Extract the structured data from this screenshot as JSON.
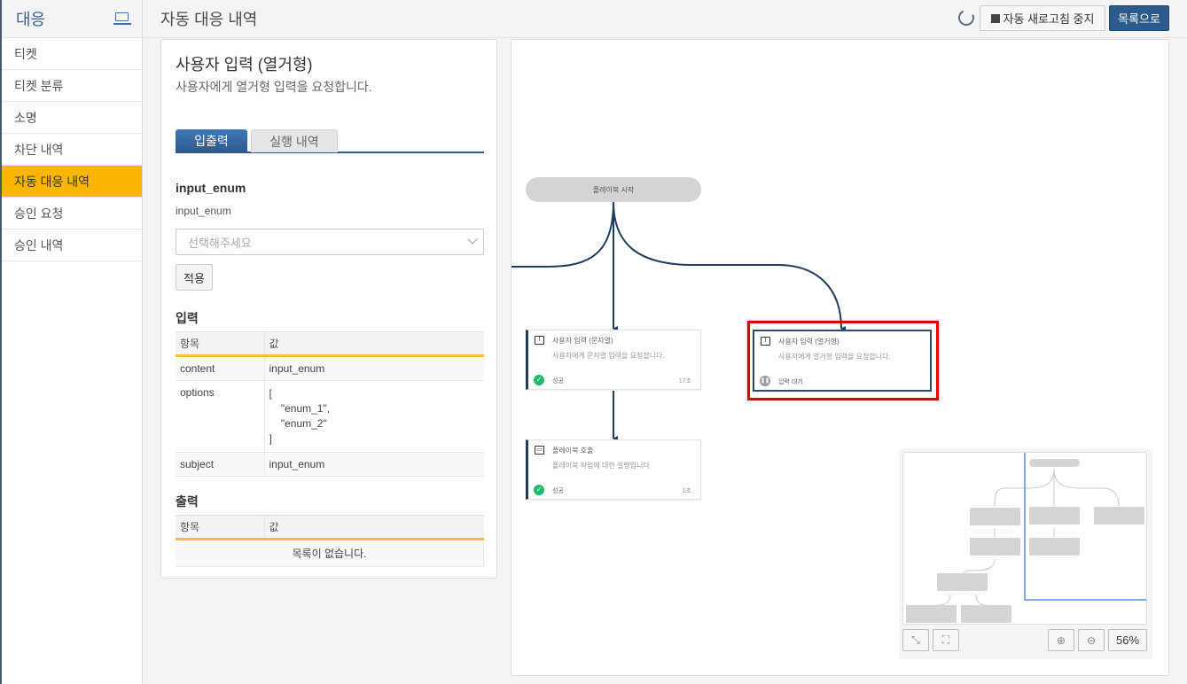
{
  "sidebar": {
    "title": "대응",
    "icon": "laptop-icon",
    "items": [
      {
        "label": "티켓",
        "active": false
      },
      {
        "label": "티켓 분류",
        "active": false
      },
      {
        "label": "소명",
        "active": false
      },
      {
        "label": "차단 내역",
        "active": false
      },
      {
        "label": "자동 대응 내역",
        "active": true
      },
      {
        "label": "승인 요청",
        "active": false
      },
      {
        "label": "승인 내역",
        "active": false
      }
    ]
  },
  "header": {
    "title": "자동 대응 내역",
    "refresh_button": "자동 새로고침 중지",
    "list_button": "목록으로"
  },
  "detail": {
    "title": "사용자 입력 (열거형)",
    "description": "사용자에게 열거형 입력을 요청합니다.",
    "tabs": [
      {
        "label": "입출력",
        "active": true
      },
      {
        "label": "실행 내역",
        "active": false
      }
    ],
    "field": {
      "name": "input_enum",
      "label": "input_enum",
      "select_placeholder": "선택해주세요",
      "apply_button": "적용"
    },
    "input_section": {
      "title": "입력",
      "columns": [
        "항목",
        "값"
      ],
      "rows": [
        {
          "key": "content",
          "value": "input_enum"
        },
        {
          "key": "options",
          "value": "[\n    \"enum_1\",\n    \"enum_2\"\n]"
        },
        {
          "key": "subject",
          "value": "input_enum"
        }
      ]
    },
    "output_section": {
      "title": "출력",
      "columns": [
        "항목",
        "값"
      ],
      "empty_text": "목록이 없습니다."
    }
  },
  "flow": {
    "start_label": "플레이북 시작",
    "nodes": [
      {
        "title": "사용자 입력 (문자열)",
        "description": "사용자에게 문자열 입력을 요청합니다.",
        "status": "성공",
        "duration": "17초",
        "icon": "text-cursor-icon"
      },
      {
        "title": "사용자 입력 (열거형)",
        "description": "사용자에게 열거형 입력을 요청합니다.",
        "status": "입력 대기",
        "duration": "",
        "icon": "text-cursor-icon"
      },
      {
        "title": "플레이북 호출",
        "description": "플레이북 작업에 대한 설명입니다",
        "status": "성공",
        "duration": "1초",
        "icon": "window-icon"
      }
    ],
    "edge_color": "#1f3d5e",
    "highlight_color": "#e00000",
    "minimap": {
      "zoom_label": "56%"
    }
  }
}
